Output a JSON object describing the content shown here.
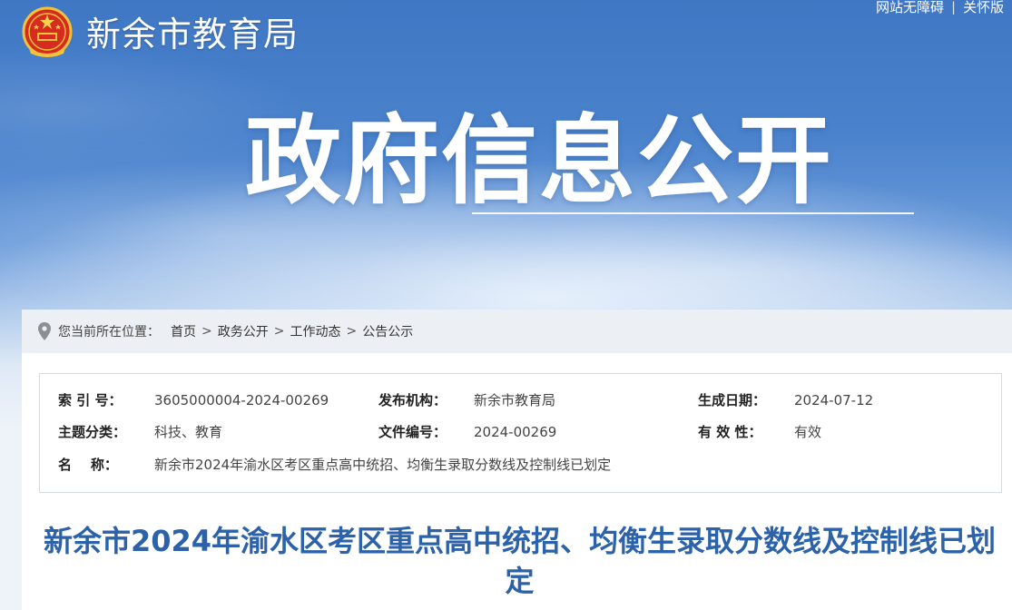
{
  "header": {
    "site_title": "新余市教育局",
    "links": [
      "网站无障碍",
      "关怀版"
    ],
    "hero_title": "政府信息公开"
  },
  "breadcrumb": {
    "label": "您当前所在位置：",
    "items": [
      "首页",
      "政务公开",
      "工作动态",
      "公告公示"
    ],
    "separator": ">"
  },
  "meta": {
    "index_no_label": "索 引 号：",
    "index_no": "3605000004-2024-00269",
    "publisher_label": "发布机构：",
    "publisher": "新余市教育局",
    "created_label": "生成日期：",
    "created": "2024-07-12",
    "topic_label": "主题分类：",
    "topic": "科技、教育",
    "doc_no_label": "文件编号：",
    "doc_no": "2024-00269",
    "validity_label": "有 效 性：",
    "validity": "有效",
    "name_label": "名    称：",
    "name": "新余市2024年渝水区考区重点高中统招、均衡生录取分数线及控制线已划定"
  },
  "article": {
    "title": "新余市2024年渝水区考区重点高中统招、均衡生录取分数线及控制线已划定"
  },
  "colors": {
    "title_blue": "#2b62a9",
    "banner_blue": "#3f77c4"
  },
  "icons": {
    "emblem": "national-emblem-icon",
    "breadcrumb": "location-pin-icon"
  }
}
